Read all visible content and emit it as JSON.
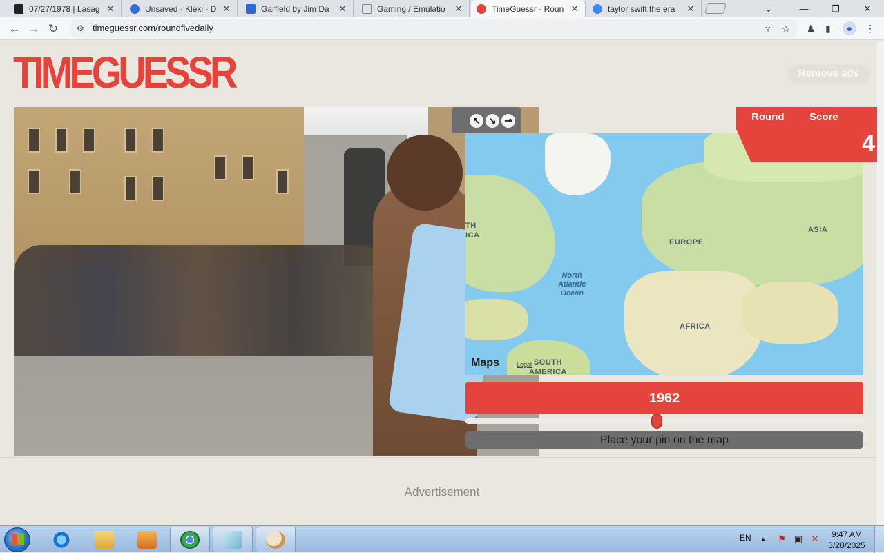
{
  "browser": {
    "tabs": [
      {
        "title": "07/27/1978 | Lasag",
        "favicon_color": "#222222"
      },
      {
        "title": "Unsaved - Kleki - D",
        "favicon_color": "#2f6fd6"
      },
      {
        "title": "Garfield by Jim Da",
        "favicon_color": "#2a6ad1"
      },
      {
        "title": "Gaming / Emulatio",
        "favicon_color": "#888888"
      },
      {
        "title": "TimeGuessr - Roun",
        "favicon_color": "#e4443b",
        "active": true
      },
      {
        "title": "taylor swift the era",
        "favicon_color": "#4285f4"
      }
    ],
    "tab_close_glyph": "✕",
    "url": "timeguessr.com/roundfivedaily",
    "window_controls": {
      "dropdown": "⌄",
      "minimize": "—",
      "restore": "❐",
      "close": "✕"
    },
    "nav": {
      "back": "←",
      "forward": "→",
      "reload": "↻"
    }
  },
  "page": {
    "logo_text": "TIMEGUESSR",
    "remove_ads_label": "Remove ads",
    "score_panel": {
      "round_label": "Round",
      "score_label": "Score",
      "score_value": "4"
    },
    "map": {
      "tool_icons": [
        "↖",
        "↘",
        "⊸"
      ],
      "labels": {
        "north_america_partial": "TH\nICA",
        "europe": "EUROPE",
        "asia": "ASIA",
        "africa": "AFRICA",
        "south_america": "SOUTH\nAMERICA",
        "ocean": "North\nAtlantic\nOcean"
      },
      "attribution": "Maps",
      "legal": "Legal",
      "map_type_icon": "map-icon"
    },
    "year_value": "1962",
    "slider": {
      "value": 1962,
      "position_fraction": 0.48
    },
    "place_pin_text": "Place your pin on the map",
    "advertisement_label": "Advertisement"
  },
  "taskbar": {
    "language": "EN",
    "time": "9:47 AM",
    "date": "3/28/2025",
    "tray_up_arrow": "▲"
  }
}
